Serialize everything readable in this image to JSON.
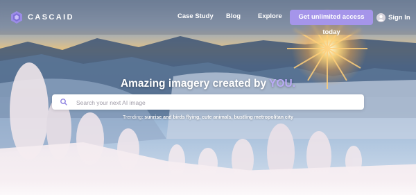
{
  "brand": {
    "name": "CASCAID",
    "accent": "#a595ea"
  },
  "nav": {
    "links": [
      "Case Study",
      "Blog",
      "Explore"
    ],
    "cta_label": "Get unlimited access today",
    "signin_label": "Sign In"
  },
  "hero": {
    "headline_prefix": "Amazing imagery created by ",
    "headline_highlight": "YOU.",
    "search_placeholder": "Search your next AI image",
    "trending_label": "Trending:",
    "trending_terms": [
      "sunrise and birds flying",
      "cute animals",
      "bustling metropolitan city"
    ],
    "separator": ", "
  },
  "icons": {
    "logo": "hexagon-logo-icon",
    "search": "search-icon",
    "user": "user-avatar-icon"
  }
}
